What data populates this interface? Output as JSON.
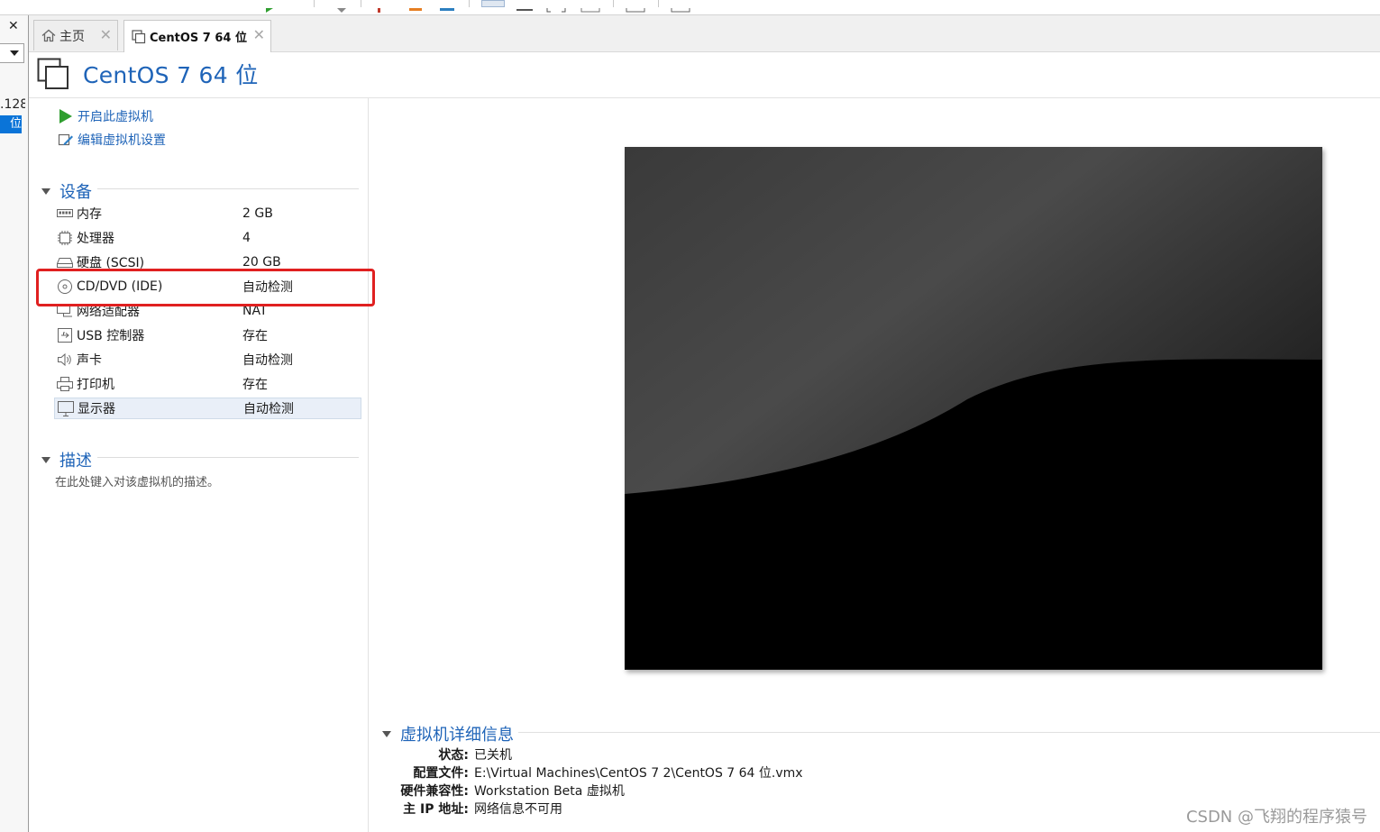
{
  "tabs": [
    {
      "label": "主页",
      "icon": "home-icon"
    },
    {
      "label": "CentOS 7 64 位",
      "icon": "vm-icon"
    }
  ],
  "library": {
    "tree_fragment_1": ".128",
    "tree_fragment_2": "位"
  },
  "vm": {
    "title": "CentOS 7 64 位"
  },
  "actions": {
    "power_on": "开启此虚拟机",
    "edit_settings": "编辑虚拟机设置"
  },
  "devices": {
    "title": "设备",
    "items": [
      {
        "name": "内存",
        "value": "2 GB",
        "icon": "memory-icon"
      },
      {
        "name": "处理器",
        "value": "4",
        "icon": "cpu-icon"
      },
      {
        "name": "硬盘 (SCSI)",
        "value": "20 GB",
        "icon": "hard-disk-icon"
      },
      {
        "name": "CD/DVD (IDE)",
        "value": "自动检测",
        "icon": "cd-dvd-icon"
      },
      {
        "name": "网络适配器",
        "value": "NAT",
        "icon": "network-adapter-icon"
      },
      {
        "name": "USB 控制器",
        "value": "存在",
        "icon": "usb-icon"
      },
      {
        "name": "声卡",
        "value": "自动检测",
        "icon": "sound-card-icon"
      },
      {
        "name": "打印机",
        "value": "存在",
        "icon": "printer-icon"
      },
      {
        "name": "显示器",
        "value": "自动检测",
        "icon": "display-icon"
      }
    ],
    "highlighted_item": "CD/DVD (IDE)",
    "highlight_color": "#e02020"
  },
  "description": {
    "title": "描述",
    "placeholder": "在此处键入对该虚拟机的描述。"
  },
  "details": {
    "title": "虚拟机详细信息",
    "rows": [
      {
        "key": "状态:",
        "value": "已关机"
      },
      {
        "key": "配置文件:",
        "value": "E:\\Virtual Machines\\CentOS 7 2\\CentOS 7 64 位.vmx"
      },
      {
        "key": "硬件兼容性:",
        "value": "Workstation Beta 虚拟机"
      },
      {
        "key": "主 IP 地址:",
        "value": "网络信息不可用"
      }
    ]
  },
  "watermark": "CSDN @飞翔的程序猿号",
  "colors": {
    "accent": "#1f64b8",
    "selection": "#0a74d8",
    "play_green": "#2f9e2f"
  }
}
